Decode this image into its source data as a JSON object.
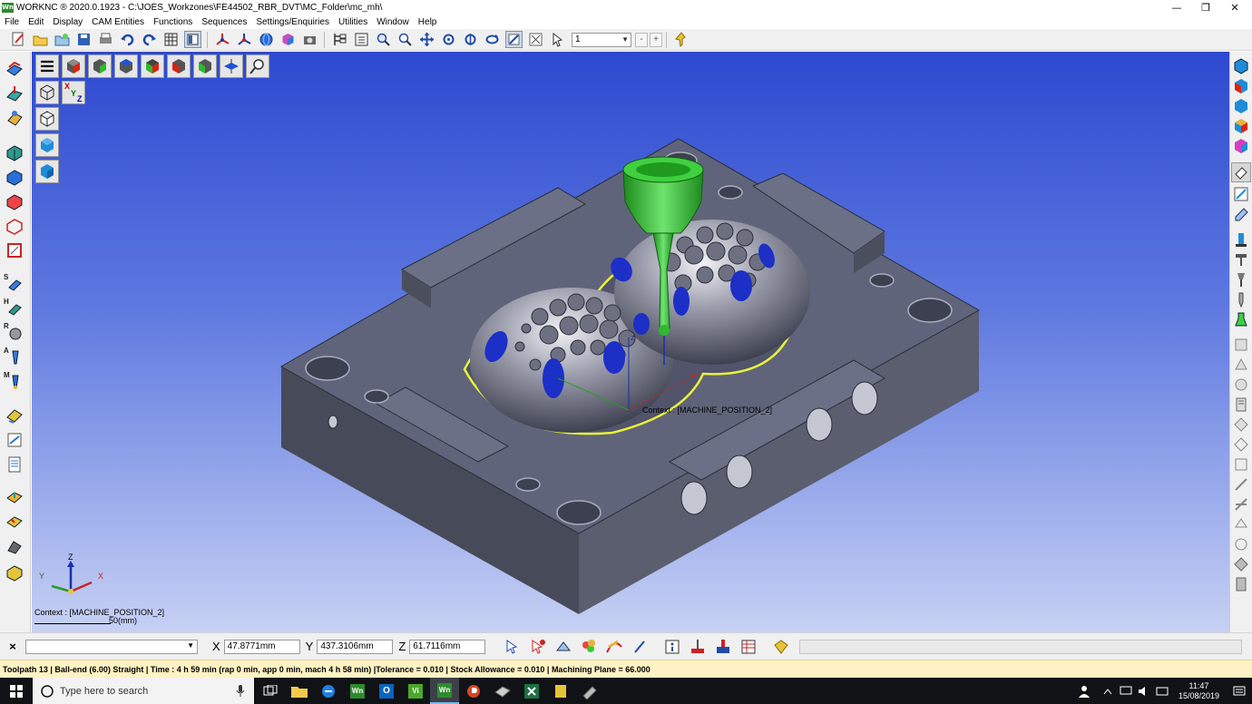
{
  "window": {
    "app_logo": "Wn",
    "title": "WORKNC ® 2020.0.1923 - C:\\JOES_Workzones\\FE44502_RBR_DVT\\MC_Folder\\mc_mh\\",
    "minimize": "—",
    "restore": "❐",
    "close": "✕"
  },
  "menu": {
    "items": [
      "File",
      "Edit",
      "Display",
      "CAM Entities",
      "Functions",
      "Sequences",
      "Settings/Enquiries",
      "Utilities",
      "Window",
      "Help"
    ]
  },
  "toolbar": {
    "combo_value": "1",
    "minus": "-",
    "plus": "+"
  },
  "viewport": {
    "context_label": "Context : [MACHINE_POSITION_2]",
    "triad_label": "Context : [MACHINE_POSITION_2]",
    "scale_label": "50(mm)",
    "axis_x": "X",
    "axis_y": "Y",
    "axis_z": "Z",
    "triad_x": "x",
    "triad_y": "y",
    "triad_z": "z",
    "xyz_button_x": "X",
    "xyz_button_y": "Y",
    "xyz_button_z": "Z",
    "side_keys": [
      "S",
      "H",
      "R",
      "A",
      "M"
    ]
  },
  "coords": {
    "close": "×",
    "x_label": "X",
    "x_value": "47.8771mm",
    "y_label": "Y",
    "y_value": "437.3106mm",
    "z_label": "Z",
    "z_value": "61.7116mm"
  },
  "status": {
    "text": "Toolpath 13 | Ball-end (6.00) Straight | Time : 4 h 59 min (rap 0 min, app 0 min, mach 4 h 58 min) |Tolerance = 0.010 | Stock Allowance = 0.010 | Machining Plane = 66.000"
  },
  "taskbar": {
    "search_placeholder": "Type here to search",
    "time": "11:47",
    "date": "15/08/2019",
    "apps": [
      "Wn",
      "O",
      "Vi",
      "Wn"
    ]
  },
  "colors": {
    "viewport_top": "#2d49cf",
    "viewport_bottom": "#c7d1f4",
    "part": "#5f6374",
    "tool": "#2fb82f",
    "pocket_blue": "#1c2fc7",
    "contour_yellow": "#e8f23a",
    "status_bg": "#fff2c4"
  }
}
